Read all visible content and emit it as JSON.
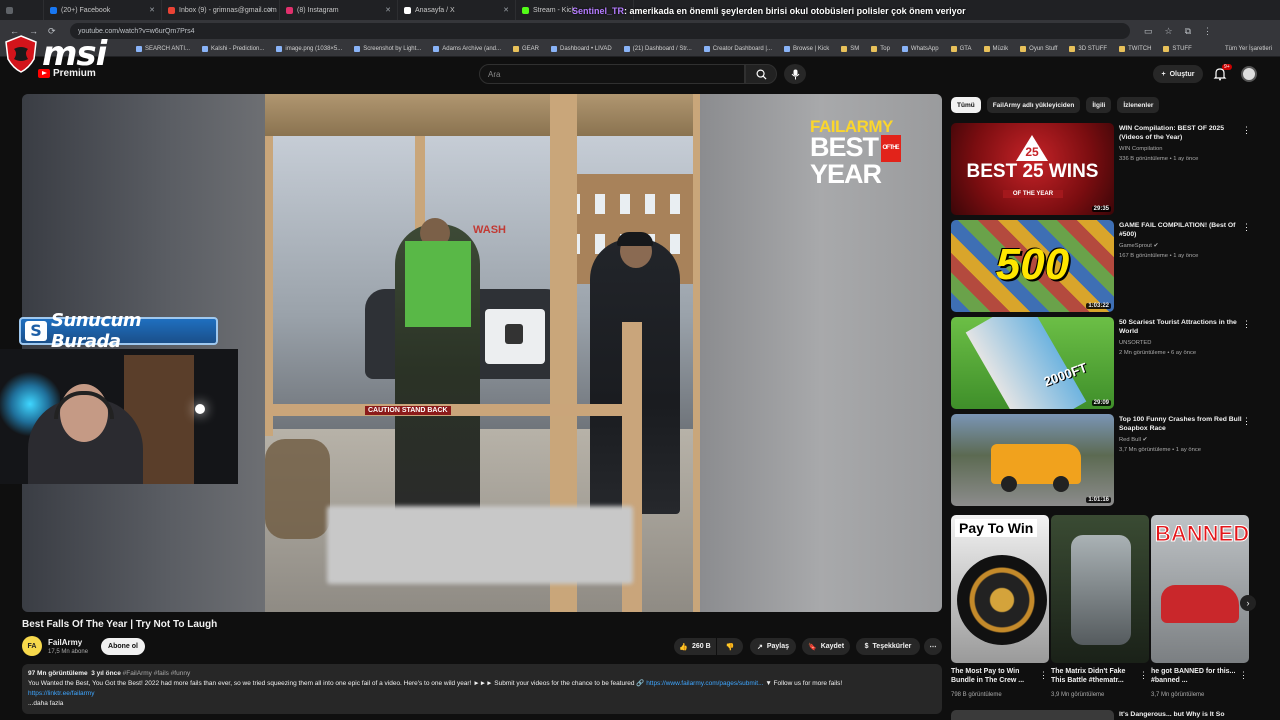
{
  "browser": {
    "tabs": [
      {
        "label": "",
        "color": "#5f6368"
      },
      {
        "label": "(20+) Facebook",
        "color": "#1877f2"
      },
      {
        "label": "Inbox (9) - grimnas@gmail.com",
        "color": "#ea4335"
      },
      {
        "label": "(8) Instagram",
        "color": "#e1306c"
      },
      {
        "label": "Anasayfa / X",
        "color": "#ffffff"
      },
      {
        "label": "Stream - Kick",
        "color": "#53fc18"
      }
    ],
    "url": "youtube.com/watch?v=w6urQm7Prs4",
    "bookmarks": [
      "SEARCH ANTI...",
      "Kalshi - Prediction...",
      "image.png (1038×5...",
      "Screenshot by Light...",
      "Adams Archive (and...",
      "GEAR",
      "Dashboard • LIVAD",
      "(21) Dashboard / Str...",
      "Creator Dashboard |...",
      "Browse | Kick",
      "SM",
      "Top",
      "WhatsApp",
      "GTA",
      "Müzik",
      "Oyun Stuff",
      "3D STUFF",
      "TWITCH",
      "STUFF"
    ],
    "bookmarks_right": "Tüm Yer İşaretleri"
  },
  "chat_overlay": {
    "user": "Sentinel_TR",
    "message": ": amerikada en önemli şeylerden birisi okul otobüsleri polisler çok önem veriyor"
  },
  "overlay_logo": "msi",
  "youtube": {
    "logo_label": "Premium",
    "search_placeholder": "Ara",
    "create_label": "Oluştur",
    "notif_badge": "9+"
  },
  "video": {
    "watermark_line1": "FAILARMY",
    "watermark_line2": "BEST",
    "watermark_of": "OF THE",
    "watermark_line3": "YEAR",
    "sign_text": "CAUTION STAND BACK",
    "wash_text": "WASH",
    "title": "Best Falls Of The Year | Try Not To Laugh",
    "channel": "FailArmy",
    "channel_initials": "FA",
    "subs": "17,5 Mn abone",
    "subscribe": "Abone ol",
    "likes": "260 B",
    "share": "Paylaş",
    "save": "Kaydet",
    "thanks": "Teşekkürler",
    "views": "97 Mn görüntüleme",
    "age": "3 yıl önce",
    "tags": "#FailArmy #fails #funny",
    "description": "You Wanted the Best, You Got the Best! 2022 had more fails than ever, so we tried squeezing them all into one epic fail of a video. Here's to one wild year! ►►► Submit your videos for the chance to be featured 🔗",
    "desc_link": "https://www.failarmy.com/pages/submit...",
    "desc_follow": "▼ Follow us for more fails!",
    "desc_link2": "https://linktr.ee/failarmy",
    "more": "...daha fazla"
  },
  "streamer_overlay": {
    "banner_icon": "S",
    "banner": "Sunucum Burada"
  },
  "sidebar": {
    "chips": [
      "Tümü",
      "FailArmy adlı yükleyiciden",
      "İlgili",
      "İzlenenler"
    ],
    "recs": [
      {
        "title": "WIN Compilation: BEST OF 2025 (Videos of the Year)",
        "channel": "WIN Compilation",
        "meta": "336 B görüntüleme • 1 ay önce",
        "duration": "29:35",
        "thumb_text": "BEST 25 WINS",
        "thumb_sub": "OF THE YEAR"
      },
      {
        "title": "GAME FAIL COMPILATION! (Best Of #500)",
        "channel": "GameSprout ✔",
        "meta": "167 B görüntüleme • 1 ay önce",
        "duration": "1:03:22",
        "thumb_text": "500"
      },
      {
        "title": "50 Scariest Tourist Attractions in the World",
        "channel": "UNSORTED",
        "meta": "2 Mn görüntüleme • 6 ay önce",
        "duration": "29:09",
        "thumb_text": "2000FT"
      },
      {
        "title": "Top 100 Funny Crashes from Red Bull Soapbox Race",
        "channel": "Red Bull ✔",
        "meta": "3,7 Mn görüntüleme • 1 ay önce",
        "duration": "1:01:16"
      }
    ],
    "shorts": [
      {
        "title": "The Most Pay to Win Bundle in The Crew ...",
        "views": "798 B görüntüleme",
        "thumb_text": "Pay To Win"
      },
      {
        "title": "The Matrix Didn't Fake This Battle #thematr...",
        "views": "3,9 Mn görüntüleme"
      },
      {
        "title": "he got BANNED for this... #banned ...",
        "views": "3,7 Mn görüntüleme",
        "thumb_text": "BANNED"
      }
    ],
    "bottom_title": "It's Dangerous... but Why is It So"
  }
}
